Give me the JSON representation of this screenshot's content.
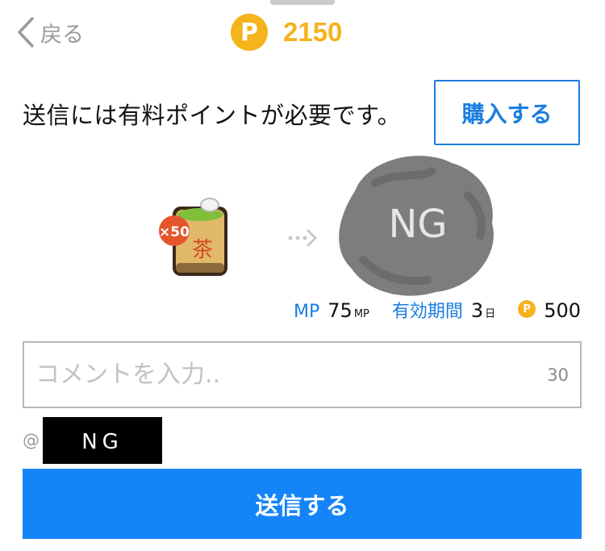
{
  "header": {
    "back_label": "戻る",
    "coin_symbol": "P",
    "points": "2150"
  },
  "notice": {
    "text": "送信には有料ポイントが必要です。",
    "buy_label": "購入する"
  },
  "gift": {
    "name": "茶",
    "quantity": "×50"
  },
  "recipient": {
    "avatar_text": "NG"
  },
  "stats": {
    "mp_label": "MP",
    "mp_value": "75",
    "mp_unit": "MP",
    "period_label": "有効期間",
    "period_value": "3",
    "period_unit": "日",
    "coin_symbol": "P",
    "cost": "500"
  },
  "comment": {
    "placeholder": "コメントを入力..",
    "max_chars": "30"
  },
  "mention": {
    "at": "@",
    "name": "NG"
  },
  "send_label": "送信する",
  "colors": {
    "accent": "#1a7de0",
    "send_button": "#1484f8",
    "coin": "#f5b31c"
  }
}
